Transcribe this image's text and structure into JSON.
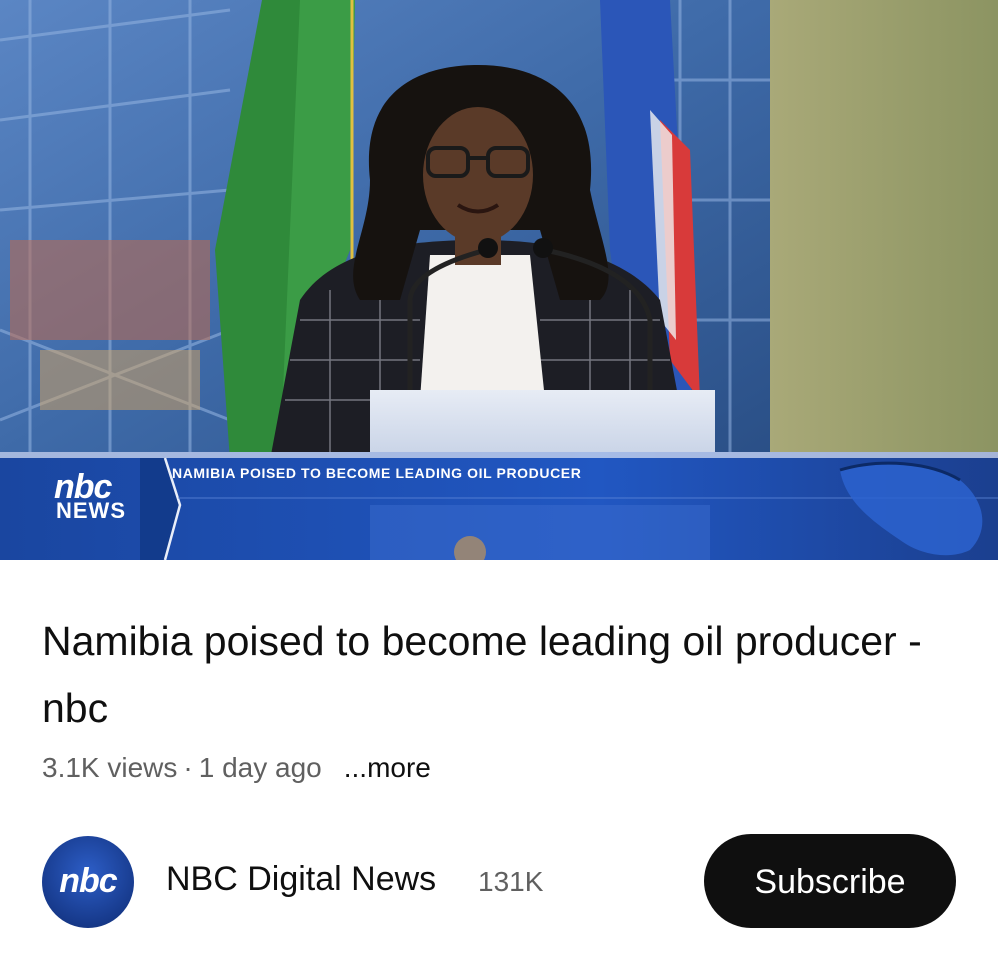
{
  "video": {
    "ticker_text": "NAMIBIA POISED TO BECOME LEADING OIL PRODUCER",
    "channel_logo_top": "nbc",
    "channel_logo_bottom": "NEWS"
  },
  "title": "Namibia poised to become leading oil producer - nbc",
  "meta": {
    "views": "3.1K views",
    "separator": "·",
    "age": "1 day ago",
    "more": "...more"
  },
  "channel": {
    "avatar_text": "nbc",
    "name": "NBC Digital News",
    "subscribers": "131K",
    "subscribe_label": "Subscribe"
  },
  "colors": {
    "subscribe_bg": "#0f0f0f",
    "ticker_blue": "#1d4aa8",
    "meta_gray": "#606060"
  }
}
